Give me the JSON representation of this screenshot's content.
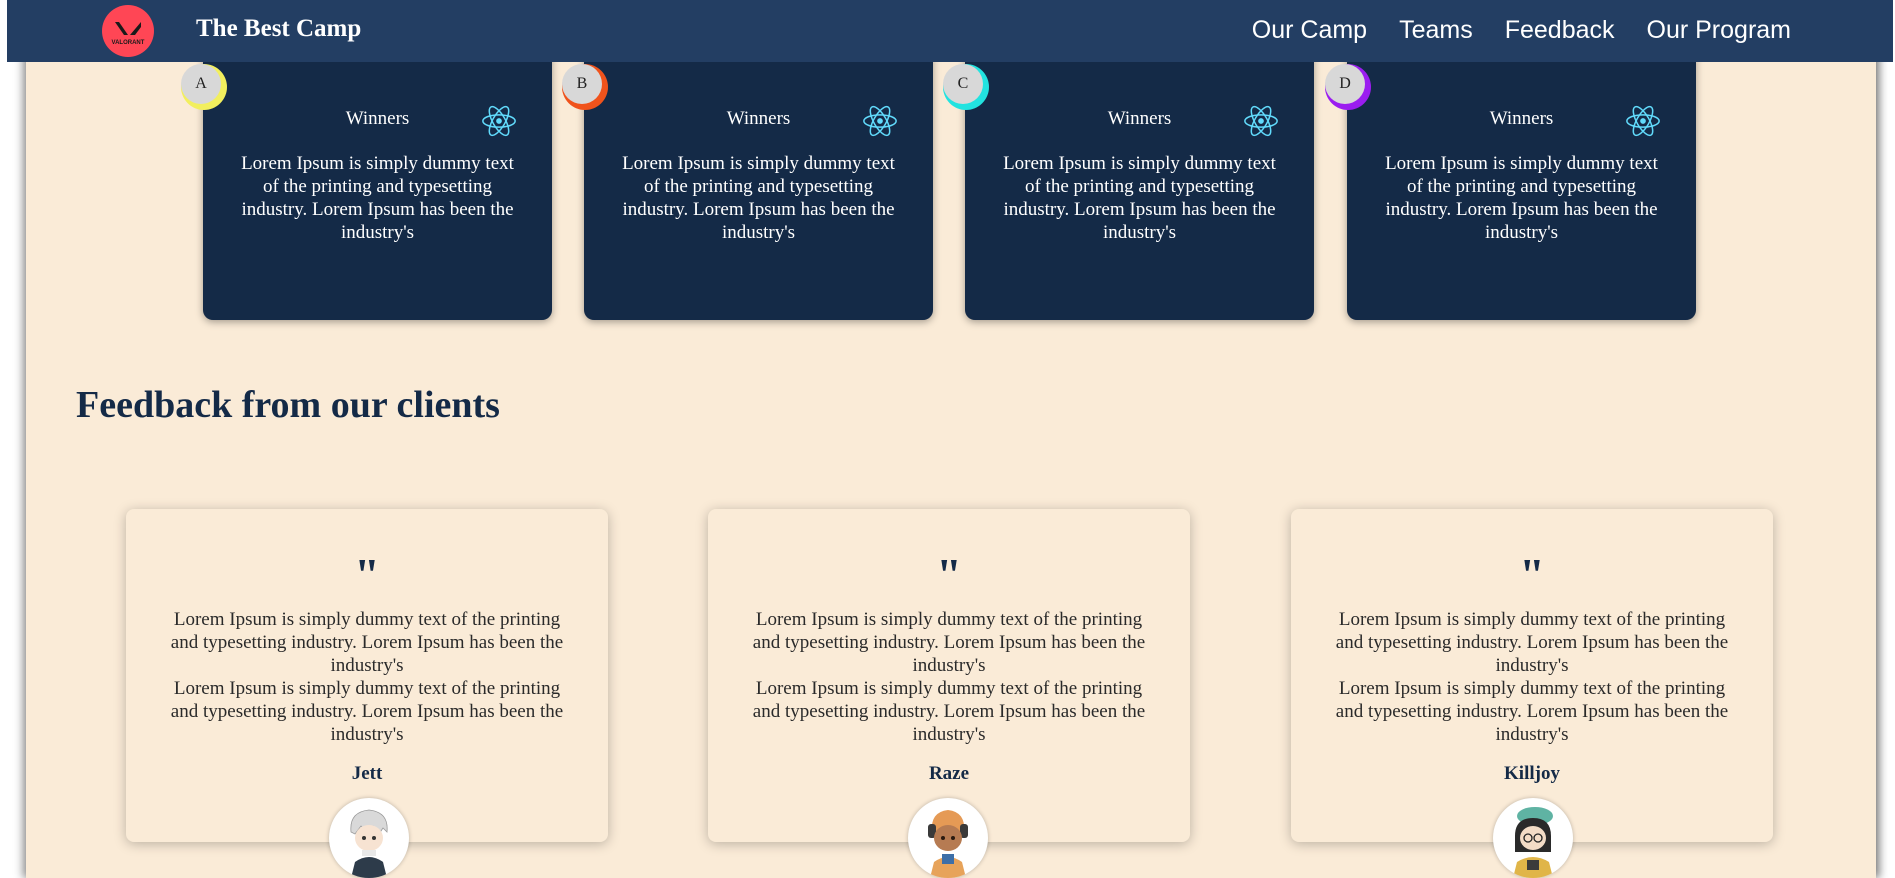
{
  "navbar": {
    "logo_text": "VALORANT",
    "brand": "The Best Camp",
    "links": [
      "Our Camp",
      "Teams",
      "Feedback",
      "Our Program"
    ]
  },
  "teams": [
    {
      "badge": "A",
      "badge_color": "#f2ef5e",
      "title": "Winners",
      "icon": "react-atom-icon",
      "text": "Lorem Ipsum is simply dummy text of the printing and typesetting industry. Lorem Ipsum has been the industry's"
    },
    {
      "badge": "B",
      "badge_color": "#f0531c",
      "title": "Winners",
      "icon": "react-atom-icon",
      "text": "Lorem Ipsum is simply dummy text of the printing and typesetting industry. Lorem Ipsum has been the industry's"
    },
    {
      "badge": "C",
      "badge_color": "#22e3e0",
      "title": "Winners",
      "icon": "react-atom-icon",
      "text": "Lorem Ipsum is simply dummy text of the printing and typesetting industry. Lorem Ipsum has been the industry's"
    },
    {
      "badge": "D",
      "badge_color": "#9b1df0",
      "title": "Winners",
      "icon": "react-atom-icon",
      "text": "Lorem Ipsum is simply dummy text of the printing and typesetting industry. Lorem Ipsum has been the industry's"
    }
  ],
  "feedback": {
    "title": "Feedback from our clients",
    "quote_mark": "\"",
    "cards": [
      {
        "text": "Lorem Ipsum is simply dummy text of the printing and typesetting industry. Lorem Ipsum has been the industry's\nLorem Ipsum is simply dummy text of the printing and typesetting industry. Lorem Ipsum has been the industry's",
        "name": "Jett"
      },
      {
        "text": "Lorem Ipsum is simply dummy text of the printing and typesetting industry. Lorem Ipsum has been the industry's\nLorem Ipsum is simply dummy text of the printing and typesetting industry. Lorem Ipsum has been the industry's",
        "name": "Raze"
      },
      {
        "text": "Lorem Ipsum is simply dummy text of the printing and typesetting industry. Lorem Ipsum has been the industry's\nLorem Ipsum is simply dummy text of the printing and typesetting industry. Lorem Ipsum has been the industry's",
        "name": "Killjoy"
      }
    ]
  },
  "colors": {
    "navbar": "#233e63",
    "page_background": "#faebd7",
    "card_dark": "#142a47",
    "accent_logo": "#ff4655",
    "react_icon": "#61dafb"
  }
}
